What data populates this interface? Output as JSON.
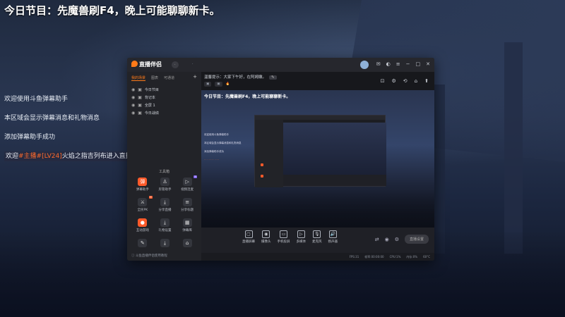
{
  "headline": "今日节目：先魔兽刷F4，晚上可能聊聊新卡。",
  "chat": {
    "line1": "欢迎使用斗鱼弹幕助手",
    "line2": "本区域会显示弹幕消息和礼物消息",
    "line3": "添加弹幕助手成功",
    "line4_prefix": "欢迎",
    "line4_role": "#主播#",
    "line4_level": "[LV24]",
    "line4_user": "火焰之指吉列布",
    "line4_suffix": "进入直播间"
  },
  "app": {
    "logo": "直播伴侣",
    "left_tabs": [
      "我的场景",
      "图表",
      "可通道"
    ],
    "scenes": [
      "今日节目",
      "背记本",
      "全屏 1",
      "今日战绩"
    ],
    "tools_title": "工具箱",
    "tools": [
      {
        "label": "弹幕助手",
        "icon": "弹",
        "style": "red"
      },
      {
        "label": "房管助手",
        "icon": "♙",
        "style": ""
      },
      {
        "label": "视频连麦",
        "icon": "▷",
        "style": ""
      },
      {
        "label": "全民PK",
        "icon": "⚔",
        "style": ""
      },
      {
        "label": "分享直播",
        "icon": "⤓",
        "style": ""
      },
      {
        "label": "分享标题",
        "icon": "≡",
        "style": ""
      },
      {
        "label": "互动游戏",
        "icon": "●",
        "style": "red"
      },
      {
        "label": "礼物设置",
        "icon": "⤓",
        "style": ""
      },
      {
        "label": "弹幕库",
        "icon": "▦",
        "style": ""
      },
      {
        "label": "",
        "icon": "✎",
        "style": ""
      },
      {
        "label": "",
        "icon": "⤓",
        "style": ""
      },
      {
        "label": "",
        "icon": "⌂",
        "style": ""
      }
    ],
    "left_footer": "斗鱼直播伴侣使用教程",
    "notice": "温馨提示：大家下午好，在阿姆嫩。",
    "main_tools": [
      "⊡",
      "⚙",
      "⟲",
      "⌂",
      "⬆"
    ],
    "preview_title": "今日节目：先魔兽刷F4，晚上可能聊聊新卡。",
    "preview_lines": [
      "欢迎使用斗鱼弹幕助手",
      "本区域会显示弹幕消息和礼物消息",
      "添加弹幕助手成功"
    ],
    "bottom_tools": [
      {
        "label": "直播屏幕",
        "icon": "▢"
      },
      {
        "label": "摄像头",
        "icon": "◉"
      },
      {
        "label": "手机投屏",
        "icon": "▭"
      },
      {
        "label": "多媒体",
        "icon": "▷"
      },
      {
        "label": "麦克风",
        "icon": "🎙"
      },
      {
        "label": "扬声器",
        "icon": "🔊"
      }
    ],
    "live_button": "直播设置",
    "status": [
      "FPS:31",
      "帧率:00:00:00",
      "CPU:1%",
      "内存:0%",
      "60°C"
    ]
  },
  "colors": {
    "accent": "#ff7a18",
    "highlight": "#ff6a2b"
  }
}
